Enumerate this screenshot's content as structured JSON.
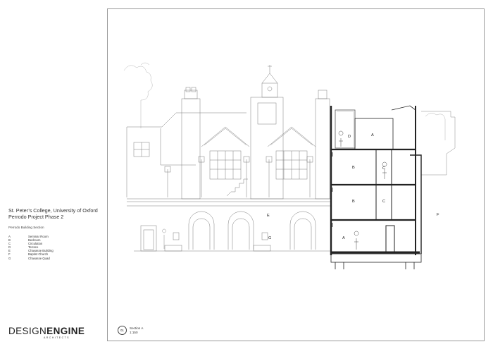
{
  "project": {
    "college": "St. Peter’s College, University of Oxford",
    "phase": "Perrodo Project Phase 2",
    "drawing_title": "Perrodo Building Section"
  },
  "legend": [
    {
      "key": "A",
      "label": "Seminar Room"
    },
    {
      "key": "B",
      "label": "Bedroom"
    },
    {
      "key": "C",
      "label": "Circulation"
    },
    {
      "key": "D",
      "label": "Terrace"
    },
    {
      "key": "E",
      "label": "Chavasse Building"
    },
    {
      "key": "F",
      "label": "Baptist Church"
    },
    {
      "key": "G",
      "label": "Chavasse Quad"
    }
  ],
  "logo": {
    "design": "DESIGN",
    "engine": "ENGINE",
    "sub": "ARCHITECTS"
  },
  "drawing_label": {
    "number": "01",
    "name": "Section A",
    "scale": "1:150"
  },
  "section_labels": {
    "a_top": "A",
    "d": "D",
    "b_mid": "B",
    "c_mid": "C",
    "b_low": "B",
    "c_low": "C",
    "a_low": "A",
    "e": "E",
    "g": "G",
    "f": "F"
  }
}
